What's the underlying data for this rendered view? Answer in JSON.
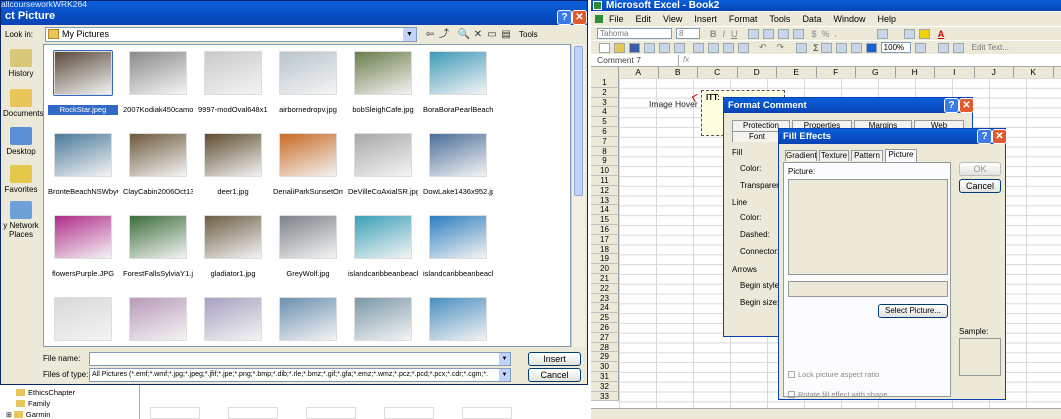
{
  "insert_dialog": {
    "title_partial": "allcourseworkWRK264",
    "title": "ct Picture",
    "look_in_label": "Look in:",
    "look_in_value": "My Pictures",
    "tools_label": "Tools",
    "places": [
      "History",
      "Documents",
      "Desktop",
      "Favorites",
      "y Network Places"
    ],
    "files": [
      {
        "name": "RockStar.jpeg",
        "color": "#5a4a3a"
      },
      {
        "name": "2007Kodiak450camoG...",
        "color": "#8a8a8a"
      },
      {
        "name": "9997-modOval648x10...",
        "color": "#c9c9c9"
      },
      {
        "name": "airbornedropv.jpg",
        "color": "#b8c4cc"
      },
      {
        "name": "bobSleighCafe.jpg",
        "color": "#6a7d4a"
      },
      {
        "name": "BoraBoraPearlBeach10...",
        "color": "#3f9ab8"
      },
      {
        "name": "BronteBeachNSWbyC...",
        "color": "#4a7a9a"
      },
      {
        "name": "ClayCabin2006Oct137...",
        "color": "#6d5a3c"
      },
      {
        "name": "deer1.jpg",
        "color": "#5e4c2e"
      },
      {
        "name": "DenaliParkSunsetOme...",
        "color": "#c86a24"
      },
      {
        "name": "DeVilleCoAxialSR.jpg",
        "color": "#a8a8a8"
      },
      {
        "name": "DowLake1436x952.jpg",
        "color": "#4a6e98"
      },
      {
        "name": "flowersPurple.JPG",
        "color": "#b02c8a"
      },
      {
        "name": "ForestFallsSylviaY1.jpg",
        "color": "#3c6e3c"
      },
      {
        "name": "gladiator1.jpg",
        "color": "#6e5e44"
      },
      {
        "name": "GreyWolf.jpg",
        "color": "#7c8288"
      },
      {
        "name": "islandcaribbeanbeach3...",
        "color": "#3aa0b8"
      },
      {
        "name": "islandcaribbeanbeach...",
        "color": "#2c7ec0"
      },
      {
        "name": "",
        "color": "#d8d8d8"
      },
      {
        "name": "",
        "color": "#b89ab8"
      },
      {
        "name": "",
        "color": "#a8a0c0"
      },
      {
        "name": "",
        "color": "#6a90b0"
      },
      {
        "name": "",
        "color": "#7a98a8"
      },
      {
        "name": "",
        "color": "#4a8ec0"
      }
    ],
    "file_name_label": "File name:",
    "file_name_value": "",
    "files_of_type_label": "Files of type:",
    "files_of_type_value": "All Pictures (*.emf;*.wmf;*.jpg;*.jpeg;*.jfif;*.jpe;*.png;*.bmp;*.dib;*.rle;*.bmz;*.gif;*.gfa;*.emz;*.wmz;*.pcz;*.pcd;*.pcx;*.cdr;*.cgm;*.",
    "insert_label": "Insert",
    "cancel_label": "Cancel"
  },
  "tree": [
    "EthicsChapter",
    "Family",
    "Garmin"
  ],
  "excel": {
    "title": "Microsoft Excel - Book2",
    "menu": [
      "File",
      "Edit",
      "View",
      "Insert",
      "Format",
      "Tools",
      "Data",
      "Window",
      "Help"
    ],
    "font_name": "Tahoma",
    "font_size": "8",
    "zoom": "100%",
    "edit_text_label": "Edit Text...",
    "name_box": "Comment 7",
    "fx": "fx",
    "columns": [
      "A",
      "B",
      "C",
      "D",
      "E",
      "F",
      "G",
      "H",
      "I",
      "J",
      "K"
    ],
    "rows": [
      "1",
      "2",
      "3",
      "4",
      "5",
      "6",
      "7",
      "8",
      "9",
      "10",
      "11",
      "12",
      "13",
      "14",
      "15",
      "16",
      "17",
      "18",
      "19",
      "20",
      "21",
      "22",
      "23",
      "24",
      "25",
      "26",
      "27",
      "28",
      "29",
      "30",
      "31",
      "32",
      "33"
    ],
    "cell_text": "Image Hover",
    "comment_text": "ITT:"
  },
  "format_comment": {
    "title": "Format Comment",
    "tabs": [
      "Protection",
      "Properties",
      "Margins",
      "Web"
    ],
    "tab2": [
      "Font"
    ],
    "section_fill": "Fill",
    "color": "Color:",
    "transparency": "Transparenc",
    "section_line": "Line",
    "line_color": "Color:",
    "dashed": "Dashed:",
    "connector": "Connector:",
    "section_arrows": "Arrows",
    "begin_style": "Begin style:",
    "begin_size": "Begin size:"
  },
  "fill_effects": {
    "title": "Fill Effects",
    "tabs": [
      "Gradient",
      "Texture",
      "Pattern",
      "Picture"
    ],
    "picture_label": "Picture:",
    "ok": "OK",
    "cancel": "Cancel",
    "select_picture": "Select Picture...",
    "sample": "Sample:",
    "lock": "Lock picture aspect ratio",
    "rotate": "Rotate fill effect with shape"
  }
}
